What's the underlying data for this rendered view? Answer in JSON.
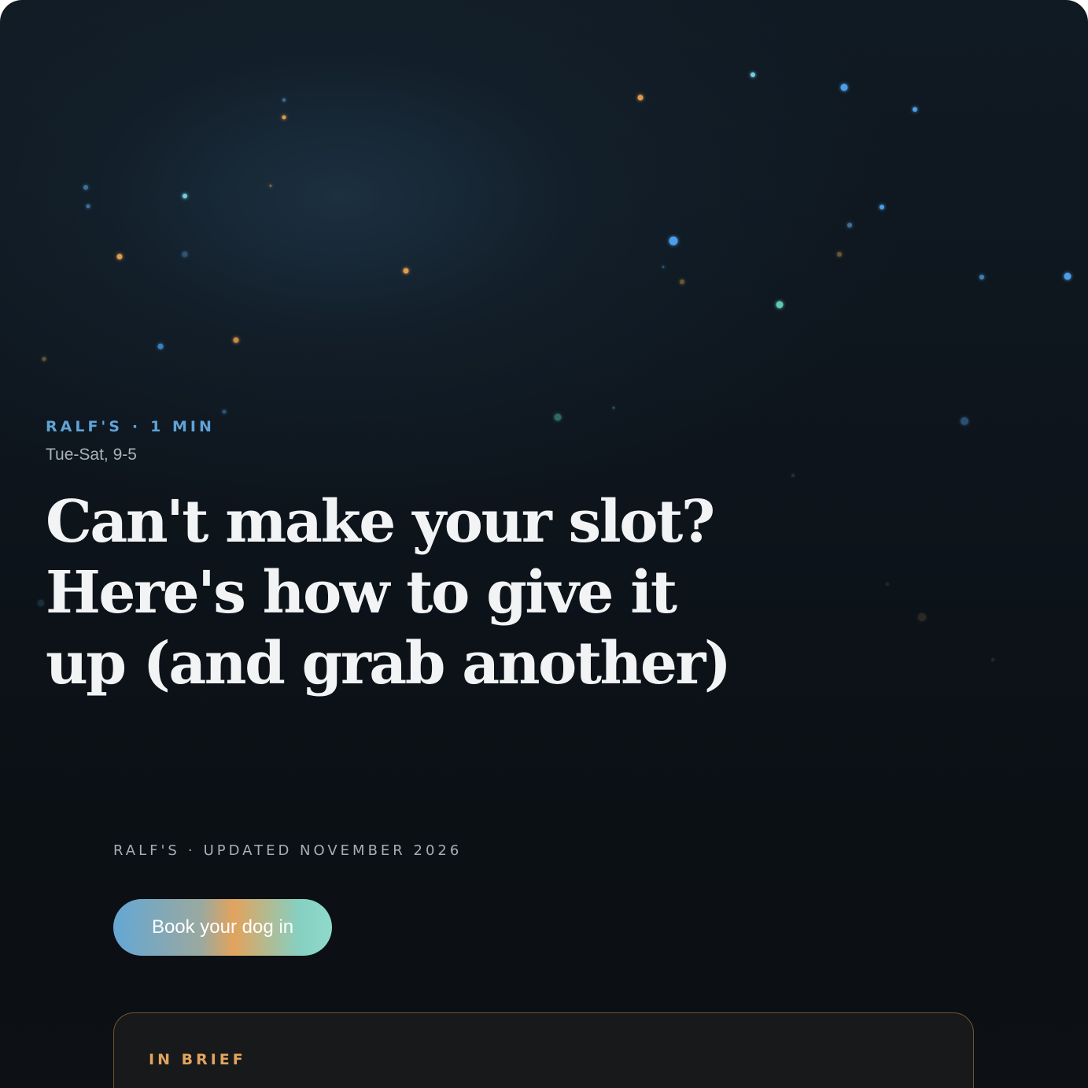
{
  "hero": {
    "brand": "RALF'S",
    "separator": "·",
    "read_time": "1 MIN",
    "hours": "Tue-Sat, 9-5",
    "headline": "Can't make your slot? Here's how to give it up (and grab another)"
  },
  "meta": {
    "brand": "RALF'S",
    "separator": "·",
    "updated": "UPDATED NOVEMBER 2026"
  },
  "cta": {
    "label": "Book your dog in"
  },
  "brief": {
    "label": "IN BRIEF"
  },
  "colors": {
    "accent_blue": "#5fa3d8",
    "accent_orange": "#e2a35d",
    "accent_teal": "#86d0c2",
    "background": "#0d141b",
    "headline": "#f2f3f5"
  }
}
